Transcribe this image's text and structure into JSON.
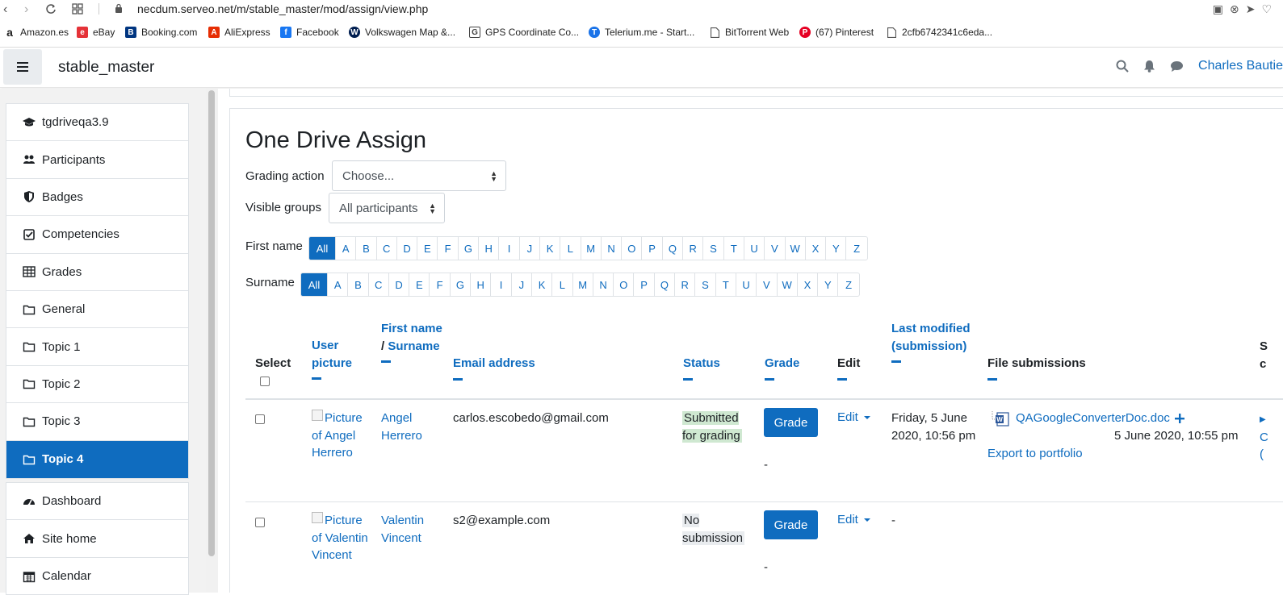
{
  "browser": {
    "url": "necdum.serveo.net/m/stable_master/mod/assign/view.php",
    "bookmarks": [
      {
        "label": "Amazon.es",
        "icon": "amazon-icon",
        "color": "#222222"
      },
      {
        "label": "eBay",
        "icon": "ebay-icon",
        "color": "#e53238"
      },
      {
        "label": "Booking.com",
        "icon": "booking-icon",
        "color": "#003580"
      },
      {
        "label": "AliExpress",
        "icon": "aliexpress-icon",
        "color": "#e62e04"
      },
      {
        "label": "Facebook",
        "icon": "facebook-icon",
        "color": "#1877f2"
      },
      {
        "label": "Volkswagen Map &...",
        "icon": "volkswagen-icon",
        "color": "#001e50"
      },
      {
        "label": "GPS Coordinate Co...",
        "icon": "gps-icon",
        "color": "#444444"
      },
      {
        "label": "Telerium.me - Start...",
        "icon": "telerium-icon",
        "color": "#1a73e8"
      },
      {
        "label": "BitTorrent Web",
        "icon": "file-icon",
        "color": "#555555"
      },
      {
        "label": "(67) Pinterest",
        "icon": "pinterest-icon",
        "color": "#e60023"
      },
      {
        "label": "2cfb6742341c6eda...",
        "icon": "file-icon",
        "color": "#555555"
      }
    ]
  },
  "navbar": {
    "site_name": "stable_master",
    "user_name": "Charles Bautie"
  },
  "sidebar": {
    "course_items": [
      {
        "label": "tgdriveqa3.9",
        "icon": "graduation-cap-icon"
      },
      {
        "label": "Participants",
        "icon": "users-icon"
      },
      {
        "label": "Badges",
        "icon": "shield-icon"
      },
      {
        "label": "Competencies",
        "icon": "check-square-icon"
      },
      {
        "label": "Grades",
        "icon": "table-icon"
      },
      {
        "label": "General",
        "icon": "folder-icon"
      },
      {
        "label": "Topic 1",
        "icon": "folder-icon"
      },
      {
        "label": "Topic 2",
        "icon": "folder-icon"
      },
      {
        "label": "Topic 3",
        "icon": "folder-icon"
      },
      {
        "label": "Topic 4",
        "icon": "folder-icon",
        "active": true
      }
    ],
    "site_items": [
      {
        "label": "Dashboard",
        "icon": "tachometer-icon"
      },
      {
        "label": "Site home",
        "icon": "home-icon"
      },
      {
        "label": "Calendar",
        "icon": "calendar-icon"
      }
    ]
  },
  "page": {
    "title": "One Drive Assign",
    "grading_action_label": "Grading action",
    "grading_action_value": "Choose...",
    "visible_groups_label": "Visible groups",
    "visible_groups_value": "All participants",
    "first_name_label": "First name",
    "surname_label": "Surname",
    "initials_all": "All",
    "letters": [
      "A",
      "B",
      "C",
      "D",
      "E",
      "F",
      "G",
      "H",
      "I",
      "J",
      "K",
      "L",
      "M",
      "N",
      "O",
      "P",
      "Q",
      "R",
      "S",
      "T",
      "U",
      "V",
      "W",
      "X",
      "Y",
      "Z"
    ]
  },
  "table": {
    "headers": {
      "select": "Select",
      "user_picture": "User picture",
      "first_name": "First name",
      "sep": " / ",
      "surname": "Surname",
      "email": "Email address",
      "status": "Status",
      "grade": "Grade",
      "edit": "Edit",
      "last_modified": "Last modified (submission)",
      "file_submissions": "File submissions",
      "cut_header": "S c"
    },
    "rows": [
      {
        "picture_alt": "Picture of Angel Herrero",
        "first": "Angel",
        "last": "Herrero",
        "email": "carlos.escobedo@gmail.com",
        "status": "Submitted for grading",
        "grade_button": "Grade",
        "grade_value": "-",
        "edit": "Edit",
        "last_modified": "Friday, 5 June 2020, 10:56 pm",
        "file_name": "QAGoogleConverterDoc.doc",
        "file_date": "5 June 2020, 10:55 pm",
        "export": "Export to portfolio",
        "cut_text": "C ("
      },
      {
        "picture_alt": "Picture of Valentin Vincent",
        "first": "Valentin",
        "last": "Vincent",
        "email": "s2@example.com",
        "status": "No submission",
        "grade_button": "Grade",
        "grade_value": "-",
        "edit": "Edit",
        "last_modified": "-"
      }
    ]
  }
}
